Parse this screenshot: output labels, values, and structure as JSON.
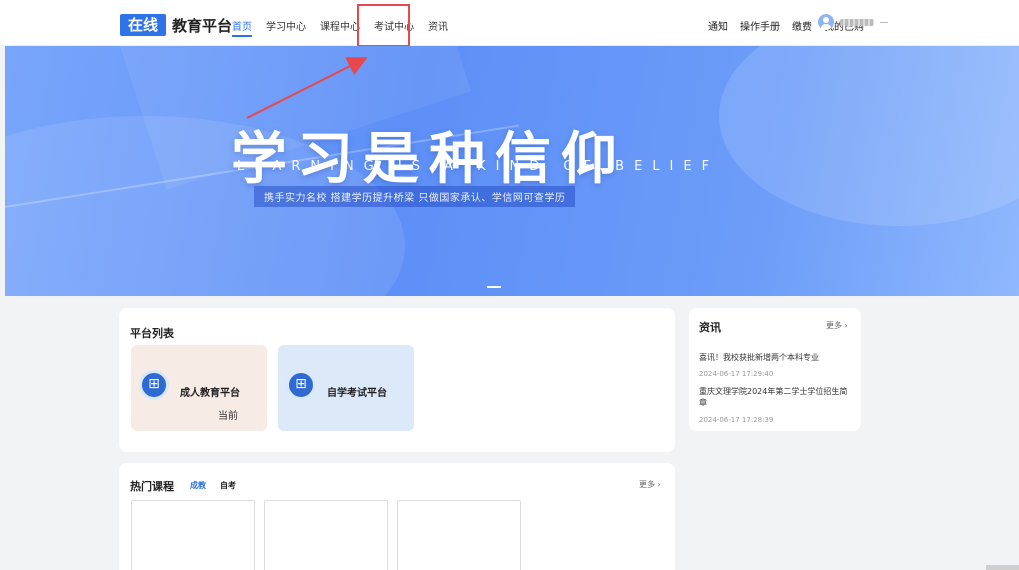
{
  "header": {
    "logo_box": "在线",
    "logo_text": "教育平台",
    "nav": [
      "首页",
      "学习中心",
      "课程中心",
      "考试中心",
      "资讯"
    ],
    "right_nav": [
      "通知",
      "操作手册",
      "缴费",
      "我的已购"
    ]
  },
  "banner": {
    "title": "学习是种信仰",
    "subtitle": "LEARNING IS A KIND OF BELIEF",
    "slogan": "携手实力名校 搭建学历提升桥梁 只做国家承认、学信网可查学历"
  },
  "platforms": {
    "title": "平台列表",
    "items": [
      {
        "name": "成人教育平台",
        "status": "当前"
      },
      {
        "name": "自学考试平台"
      }
    ]
  },
  "news": {
    "title": "资讯",
    "more": "更多 ›",
    "items": [
      {
        "title": "喜讯！我校获批新增两个本科专业",
        "date": "2024-06-17 17:29:40"
      },
      {
        "title": "重庆文理学院2024年第二学士学位招生简章",
        "date": "2024-06-17 17:28:39"
      }
    ]
  },
  "courses": {
    "title": "热门课程",
    "tabs": [
      "成教",
      "自考"
    ],
    "more": "更多 ›"
  },
  "colors": {
    "accent": "#2f73e8",
    "highlight": "#e8474c"
  }
}
